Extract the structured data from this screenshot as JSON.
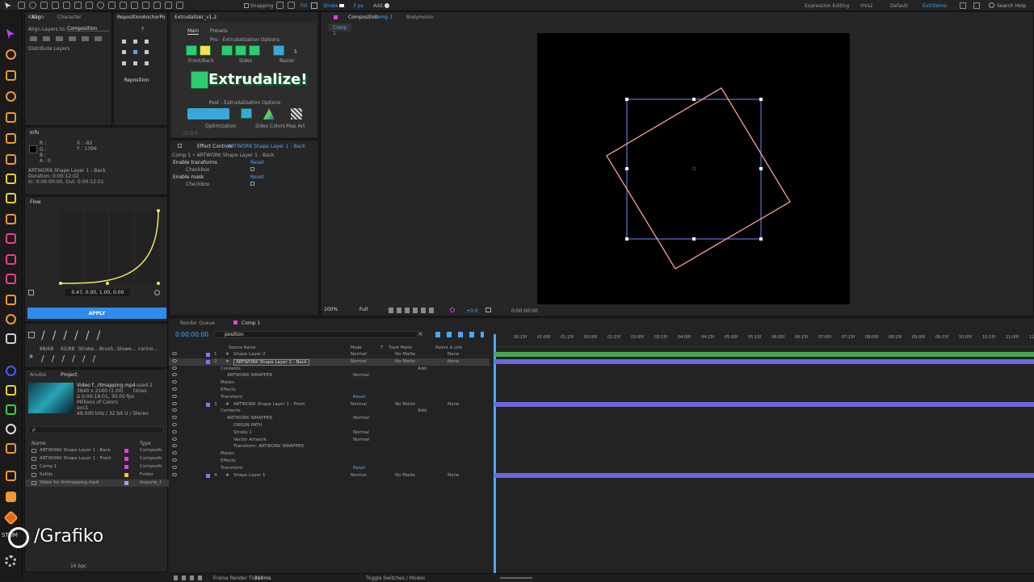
{
  "topbar": {
    "stroke_label": "Stroke",
    "fill_label": "Fill",
    "stroke_px": "3 px",
    "add_label": "Add:",
    "snapping": "Snapping",
    "workspaces": [
      "Expression Editing",
      "HVs2",
      "Default",
      "ExtrDemo"
    ],
    "search": "Search Help"
  },
  "align": {
    "tabs": [
      "KBar",
      "Align",
      "Character",
      "RepositionAnchorPo"
    ],
    "align_layers_to": "Align Layers to:",
    "target": "Composition",
    "distribute": "Distribute Layers",
    "reposition_btn": "Reposition"
  },
  "info": {
    "title": "Info",
    "r": "R :",
    "g": "G :",
    "b": "B :",
    "a": "A : 0",
    "x": "X : -82",
    "y": "Y : 1396",
    "layer": "ARTWORK Shape Layer 1 - Back",
    "duration": "Duration: 0:00:12:02",
    "in_out": "In: 0:00:00:00, Out: 0:00:12:01"
  },
  "flow": {
    "title": "Flow",
    "values": "0.47, 0.00, 1.00, 0.00",
    "apply": "APPLY",
    "presets": [
      "88/68",
      "65/88",
      "Stroke...",
      "Brush...",
      "Slowe...",
      "carino..."
    ],
    "curve": [
      0.47,
      0.0,
      1.0,
      0.0
    ]
  },
  "project": {
    "tabs": [
      "Anubis",
      "Project"
    ],
    "asset_name": "Video f...rtmapping.mp4",
    "asset_used": ", used 2 times",
    "asset_res": "3840 x 2160 (1.00)",
    "asset_dur": "Δ 0:00:18:01, 30.00 fps",
    "asset_colors": "Millions of Colors",
    "asset_codec": "avc1",
    "asset_audio": "48.000 kHz / 32 bit U / Stereo",
    "search_placeholder": "ρ",
    "col_name": "Name",
    "col_type": "Type",
    "items": [
      {
        "name": "ARTWORK Shape Layer 1 - Back",
        "type": "Compositi",
        "color": "#e040e0"
      },
      {
        "name": "ARTWORK Shape Layer 1 - Front",
        "type": "Compositi",
        "color": "#e040e0"
      },
      {
        "name": "Comp 1",
        "type": "Compositi",
        "color": "#e040e0"
      },
      {
        "name": "Solids",
        "type": "Folder",
        "color": "#e8c840"
      },
      {
        "name": "Video for Artmapping.mp4",
        "type": "Importe_f",
        "color": "#a0a0ff"
      }
    ],
    "bpc": "16 bpc"
  },
  "extrudalizer": {
    "title": "Extrudalizer_v1.2",
    "tabs": [
      "Main",
      "Presets"
    ],
    "pre_label": "Pre - Extrudalization Options",
    "front_back": "Front/Back",
    "sides": "Sides",
    "bezier": "Bezier",
    "count": "5",
    "logo": "Extrudalize!",
    "post_label": "Post - Extrudalization Options",
    "optimization": "Optimization",
    "sides_colors": "Sides Colors",
    "map_art": "Map Art",
    "version": "v1.0.0"
  },
  "effects": {
    "title": "Effect Controls",
    "target": "ARTWORK Shape Layer 1 - Back",
    "breadcrumb": "Comp 1 • ARTWORK Shape Layer 1 - Back",
    "fx1": "Enable transforms",
    "fx2": "Enable mask",
    "reset": "Reset",
    "checkbox": "Checkbox"
  },
  "comp": {
    "tab": "Composition",
    "tab_name": "Comp 1",
    "tab2": "Bodymovin",
    "crumb": "Comp 1",
    "zoom": "100%",
    "resolution": "Full",
    "exposure": "+0.0",
    "timecode": "0:00:00:00"
  },
  "timeline": {
    "tabs": [
      "Render Queue",
      "Comp 1"
    ],
    "time": "0:00:00:00",
    "search": "position",
    "cols": [
      "Source Name",
      "Mode",
      "T",
      "Track Matte",
      "Parent & Link"
    ],
    "ticks": [
      "00:15f",
      "01:00f",
      "01:15f",
      "02:00f",
      "02:15f",
      "03:00f",
      "03:15f",
      "04:00f",
      "04:15f",
      "05:00f",
      "05:15f",
      "06:00f",
      "06:15f",
      "07:00f",
      "07:15f",
      "08:00f",
      "08:15f",
      "09:00f",
      "09:15f",
      "10:00f",
      "10:15f",
      "11:00f",
      "11:15"
    ],
    "rows": [
      {
        "n": "1",
        "name": "Shape Layer 2",
        "mode": "Normal",
        "matte": "No Matte",
        "parent": "None",
        "indent": 0,
        "bar": "#4aa84a"
      },
      {
        "n": "2",
        "name": "ARTWORK Shape Layer 1 - Back",
        "mode": "Normal",
        "matte": "No Matte",
        "parent": "None",
        "indent": 0,
        "bar": "#6a6adc",
        "sel": true
      },
      {
        "n": "",
        "name": "Contents",
        "mode": "",
        "matte": "Add:",
        "parent": "",
        "indent": 1
      },
      {
        "n": "",
        "name": "ARTWORK WRAPPER",
        "mode": "Normal",
        "matte": "",
        "parent": "",
        "indent": 2
      },
      {
        "n": "",
        "name": "Masks",
        "mode": "",
        "matte": "",
        "parent": "",
        "indent": 1
      },
      {
        "n": "",
        "name": "Effects",
        "mode": "",
        "matte": "",
        "parent": "",
        "indent": 1
      },
      {
        "n": "",
        "name": "Transform",
        "mode": "Reset",
        "matte": "",
        "parent": "",
        "indent": 1
      },
      {
        "n": "3",
        "name": "ARTWORK Shape Layer 1 - Front",
        "mode": "Normal",
        "matte": "No Matte",
        "parent": "None",
        "indent": 0,
        "bar": "#6a6adc"
      },
      {
        "n": "",
        "name": "Contents",
        "mode": "",
        "matte": "Add:",
        "parent": "",
        "indent": 1
      },
      {
        "n": "",
        "name": "ARTWORK WRAPPER",
        "mode": "Normal",
        "matte": "",
        "parent": "",
        "indent": 2
      },
      {
        "n": "",
        "name": "ORIGIN PATH",
        "mode": "",
        "matte": "",
        "parent": "",
        "indent": 3
      },
      {
        "n": "",
        "name": "Stroke 1",
        "mode": "Normal",
        "matte": "",
        "parent": "",
        "indent": 3
      },
      {
        "n": "",
        "name": "Vector Artwork",
        "mode": "Normal",
        "matte": "",
        "parent": "",
        "indent": 3
      },
      {
        "n": "",
        "name": "Transform: ARTWORK WRAPPER",
        "mode": "",
        "matte": "",
        "parent": "",
        "indent": 3
      },
      {
        "n": "",
        "name": "Masks",
        "mode": "",
        "matte": "",
        "parent": "",
        "indent": 1
      },
      {
        "n": "",
        "name": "Effects",
        "mode": "",
        "matte": "",
        "parent": "",
        "indent": 1
      },
      {
        "n": "",
        "name": "Transform",
        "mode": "Reset",
        "matte": "",
        "parent": "",
        "indent": 1
      },
      {
        "n": "4",
        "name": "Shape Layer 1",
        "mode": "Normal",
        "matte": "No Matte",
        "parent": "None",
        "indent": 0,
        "bar": "#6a6adc"
      }
    ],
    "frame_render": "Frame Render Time",
    "frame_ms": "218ms",
    "toggle": "Toggle Switches / Modes"
  },
  "watermark": "/Grafiko",
  "stum": "STUM"
}
